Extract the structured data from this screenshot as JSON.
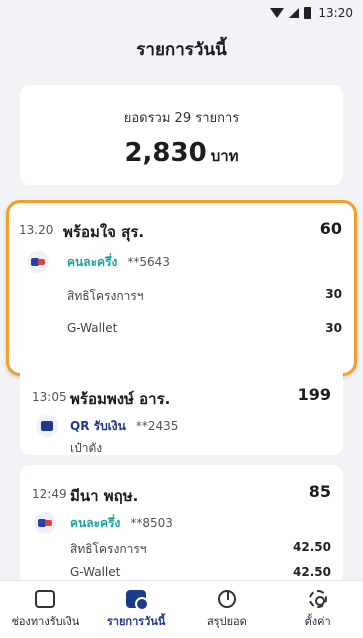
{
  "status": {
    "time": "13:20"
  },
  "header": {
    "title": "รายการวันนี้"
  },
  "summary": {
    "label": "ยอดรวม 29 รายการ",
    "amount": "2,830",
    "unit": "บาท"
  },
  "transactions": [
    {
      "time": "13.20",
      "name": "พร้อมใจ สุร.",
      "amount": "60",
      "method": "คนละครึ่ง",
      "ref": "**5643",
      "lines": [
        {
          "label": "สิทธิโครงการฯ",
          "amount": "30"
        },
        {
          "label": "G-Wallet",
          "amount": "30"
        }
      ]
    },
    {
      "time": "13:05",
      "name": "พร้อมพงษ์ อาร.",
      "amount": "199",
      "method": "QR รับเงิน",
      "ref": "**2435",
      "lines": [
        {
          "label": "เป๋าตัง",
          "amount": ""
        }
      ]
    },
    {
      "time": "12:49",
      "name": "มีนา พฤษ.",
      "amount": "85",
      "method": "คนละครึ่ง",
      "ref": "**8503",
      "lines": [
        {
          "label": "สิทธิโครงการฯ",
          "amount": "42.50"
        },
        {
          "label": "G-Wallet",
          "amount": "42.50"
        }
      ]
    }
  ],
  "nav": [
    {
      "label": "ช่องทางรับเงิน",
      "icon": "wallet-icon"
    },
    {
      "label": "รายการวันนี้",
      "icon": "list-icon"
    },
    {
      "label": "สรุปยอด",
      "icon": "pie-chart-icon"
    },
    {
      "label": "ตั้งค่า",
      "icon": "gear-icon"
    }
  ],
  "colors": {
    "accent": "#1e3a8a",
    "highlight": "#f3a02b",
    "teal": "#1fa3a0"
  }
}
